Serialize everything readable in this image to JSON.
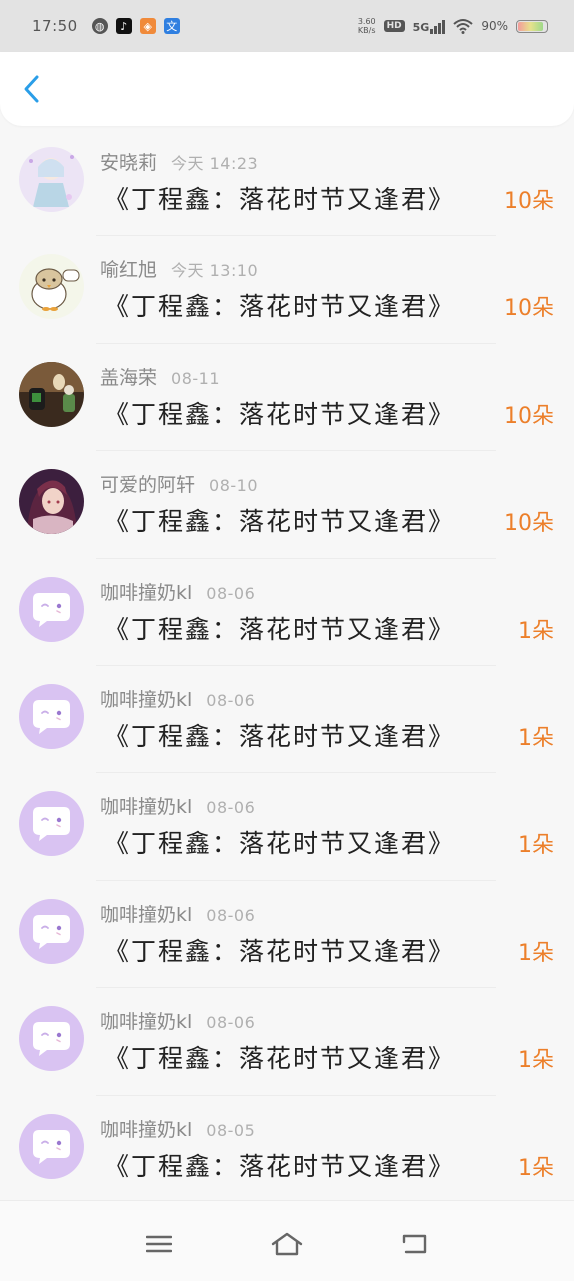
{
  "status_bar": {
    "time": "17:50",
    "net_speed_value": "3.60",
    "net_speed_unit": "KB/s",
    "hd": "HD",
    "network": "5G",
    "battery": "90%"
  },
  "messages": [
    {
      "sender": "安晓莉",
      "time": "今天 14:23",
      "title": "《丁程鑫：落花时节又逢君》",
      "gift": "10朵",
      "avatar": "anime-girl-illustration"
    },
    {
      "sender": "喻红旭",
      "time": "今天 13:10",
      "title": "《丁程鑫：落花时节又逢君》",
      "gift": "10朵",
      "avatar": "cartoon-chick"
    },
    {
      "sender": "盖海荣",
      "time": "08-11",
      "title": "《丁程鑫：落花时节又逢君》",
      "gift": "10朵",
      "avatar": "game-characters"
    },
    {
      "sender": "可爱的阿轩",
      "time": "08-10",
      "title": "《丁程鑫：落花时节又逢君》",
      "gift": "10朵",
      "avatar": "anime-portrait"
    },
    {
      "sender": "咖啡撞奶kl",
      "time": "08-06",
      "title": "《丁程鑫：落花时节又逢君》",
      "gift": "1朵",
      "avatar": "default-chat"
    },
    {
      "sender": "咖啡撞奶kl",
      "time": "08-06",
      "title": "《丁程鑫：落花时节又逢君》",
      "gift": "1朵",
      "avatar": "default-chat"
    },
    {
      "sender": "咖啡撞奶kl",
      "time": "08-06",
      "title": "《丁程鑫：落花时节又逢君》",
      "gift": "1朵",
      "avatar": "default-chat"
    },
    {
      "sender": "咖啡撞奶kl",
      "time": "08-06",
      "title": "《丁程鑫：落花时节又逢君》",
      "gift": "1朵",
      "avatar": "default-chat"
    },
    {
      "sender": "咖啡撞奶kl",
      "time": "08-06",
      "title": "《丁程鑫：落花时节又逢君》",
      "gift": "1朵",
      "avatar": "default-chat"
    },
    {
      "sender": "咖啡撞奶kl",
      "time": "08-05",
      "title": "《丁程鑫：落花时节又逢君》",
      "gift": "1朵",
      "avatar": "default-chat"
    }
  ],
  "colors": {
    "accent_blue": "#2a9ee8",
    "gift_orange": "#ec7f2a",
    "avatar_purple": "#d9c3f2"
  },
  "icons": {
    "back": "chevron-left-icon",
    "nav_menu": "menu-icon",
    "nav_home": "home-icon",
    "nav_back": "return-icon"
  }
}
